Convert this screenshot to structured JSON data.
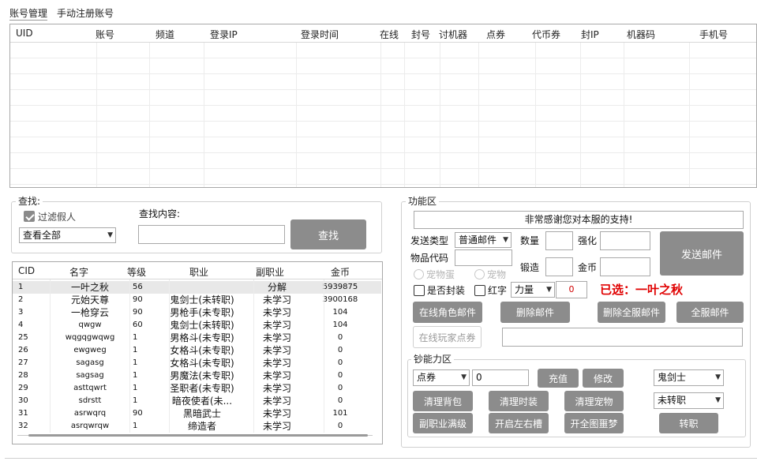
{
  "tabs": [
    {
      "label": "账号管理"
    },
    {
      "label": "手动注册账号"
    }
  ],
  "account_table": {
    "columns": [
      "UID",
      "账号",
      "频道",
      "登录IP",
      "登录时间",
      "在线",
      "封号",
      "讨机器",
      "点券",
      "代币券",
      "封IP",
      "机器码",
      "手机号"
    ]
  },
  "search": {
    "group_title": "查找:",
    "filter_fake_label": "过滤假人",
    "filter_fake_checked": true,
    "view_select": "查看全部",
    "content_label": "查找内容:",
    "content_value": "",
    "search_button": "查找"
  },
  "char_table": {
    "columns": [
      "CID",
      "名字",
      "等级",
      "职业",
      "副职业",
      "金币"
    ],
    "rows": [
      {
        "cid": "1",
        "name": "一叶之秋",
        "level": "56",
        "job": "",
        "subjob": "分解",
        "gold": "5939875"
      },
      {
        "cid": "2",
        "name": "元始天尊",
        "level": "90",
        "job": "鬼剑士(未转职)",
        "subjob": "未学习",
        "gold": "3900168"
      },
      {
        "cid": "3",
        "name": "一枪穿云",
        "level": "90",
        "job": "男枪手(未专职)",
        "subjob": "未学习",
        "gold": "104"
      },
      {
        "cid": "4",
        "name": "qwgw",
        "level": "60",
        "job": "鬼剑士(未转职)",
        "subjob": "未学习",
        "gold": "104"
      },
      {
        "cid": "25",
        "name": "wqgqgwqwg",
        "level": "1",
        "job": "男格斗(未专职)",
        "subjob": "未学习",
        "gold": "0"
      },
      {
        "cid": "26",
        "name": "ewgweg",
        "level": "1",
        "job": "女格斗(未专职)",
        "subjob": "未学习",
        "gold": "0"
      },
      {
        "cid": "27",
        "name": "sagasg",
        "level": "1",
        "job": "女格斗(未专职)",
        "subjob": "未学习",
        "gold": "0"
      },
      {
        "cid": "28",
        "name": "sagsag",
        "level": "1",
        "job": "男魔法(未专职)",
        "subjob": "未学习",
        "gold": "0"
      },
      {
        "cid": "29",
        "name": "asttqwrt",
        "level": "1",
        "job": "圣职者(未专职)",
        "subjob": "未学习",
        "gold": "0"
      },
      {
        "cid": "30",
        "name": "sdrstt",
        "level": "1",
        "job": "暗夜使者(未...",
        "subjob": "未学习",
        "gold": "0"
      },
      {
        "cid": "31",
        "name": "asrwqrq",
        "level": "90",
        "job": "黑暗武士",
        "subjob": "未学习",
        "gold": "101"
      },
      {
        "cid": "32",
        "name": "asrqwrqw",
        "level": "1",
        "job": "缔造者",
        "subjob": "未学习",
        "gold": "0"
      }
    ]
  },
  "func": {
    "group_title": "功能区",
    "banner": "非常感谢您对本服的支持!",
    "send_type_label": "发送类型",
    "send_type_value": "普通邮件",
    "quantity_label": "数量",
    "quantity_value": "",
    "enhance_label": "强化",
    "enhance_value": "",
    "send_mail_button": "发送邮件",
    "item_code_label": "物品代码",
    "item_code_value": "",
    "forge_label": "锻造",
    "forge_value": "",
    "gold_label": "金币",
    "gold_value": "",
    "pet_egg_label": "宠物蛋",
    "pet_label": "宠物",
    "sealed_label": "是否封装",
    "red_label": "红字",
    "stat_select": "力量",
    "stat_value": "0",
    "selected_text": "已选：一叶之秋",
    "selected_color": "#e00000",
    "btn_online_role_mail": "在线角色邮件",
    "btn_delete_mail": "删除邮件",
    "btn_delete_all_mail": "删除全服邮件",
    "btn_all_server_mail": "全服邮件",
    "btn_online_player_coupon": "在线玩家点券",
    "coupon_input_value": ""
  },
  "money": {
    "group_title": "钞能力区",
    "currency_select": "点券",
    "amount_value": "0",
    "recharge_button": "充值",
    "modify_button": "修改",
    "job_select": "鬼剑士",
    "advance_select": "未转职",
    "btn_clear_bag": "清理背包",
    "btn_clear_fashion": "清理时装",
    "btn_clear_pet": "清理宠物",
    "btn_subjob_max": "副职业满级",
    "btn_open_slots": "开启左右槽",
    "btn_open_map": "开全图噩梦",
    "btn_change_job": "转职"
  }
}
